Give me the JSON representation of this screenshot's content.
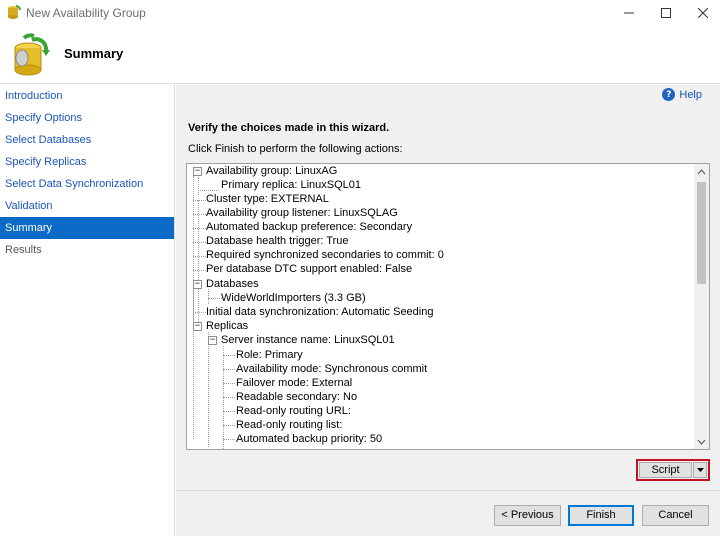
{
  "window": {
    "title": "New Availability Group"
  },
  "header": {
    "title": "Summary"
  },
  "sidebar": {
    "items": [
      {
        "label": "Introduction",
        "state": "link"
      },
      {
        "label": "Specify Options",
        "state": "link"
      },
      {
        "label": "Select Databases",
        "state": "link"
      },
      {
        "label": "Specify Replicas",
        "state": "link"
      },
      {
        "label": "Select Data Synchronization",
        "state": "link"
      },
      {
        "label": "Validation",
        "state": "link"
      },
      {
        "label": "Summary",
        "state": "active"
      },
      {
        "label": "Results",
        "state": "disabled"
      }
    ]
  },
  "main": {
    "help_label": "Help",
    "verify_text": "Verify the choices made in this wizard.",
    "instruction_text": "Click Finish to perform the following actions:",
    "tree": [
      {
        "text": "Availability group: LinuxAG",
        "expander": "-"
      },
      {
        "text": "Primary replica: LinuxSQL01"
      },
      {
        "text": "Cluster type: EXTERNAL"
      },
      {
        "text": "Availability group listener: LinuxSQLAG"
      },
      {
        "text": "Automated backup preference: Secondary"
      },
      {
        "text": "Database health trigger: True"
      },
      {
        "text": "Required synchronized secondaries to commit: 0"
      },
      {
        "text": "Per database DTC support enabled: False"
      },
      {
        "text": "Databases",
        "expander": "-"
      },
      {
        "text": "WideWorldImporters (3.3 GB)"
      },
      {
        "text": "Initial data synchronization: Automatic Seeding"
      },
      {
        "text": "Replicas",
        "expander": "-"
      },
      {
        "text": "Server instance name: LinuxSQL01",
        "expander": "-"
      },
      {
        "text": "Role: Primary"
      },
      {
        "text": "Availability mode: Synchronous commit"
      },
      {
        "text": "Failover mode: External"
      },
      {
        "text": "Readable secondary: No"
      },
      {
        "text": "Read-only routing URL:"
      },
      {
        "text": "Read-only routing list:"
      },
      {
        "text": "Automated backup priority: 50"
      }
    ]
  },
  "buttons": {
    "script": "Script",
    "previous": "< Previous",
    "finish": "Finish",
    "cancel": "Cancel"
  },
  "icons": {
    "help": "help-icon",
    "header": "database-sync-icon",
    "app": "app-icon"
  },
  "colors": {
    "active_nav": "#0a6ac6",
    "link": "#1a55b8",
    "script_highlight": "#c1121f"
  }
}
